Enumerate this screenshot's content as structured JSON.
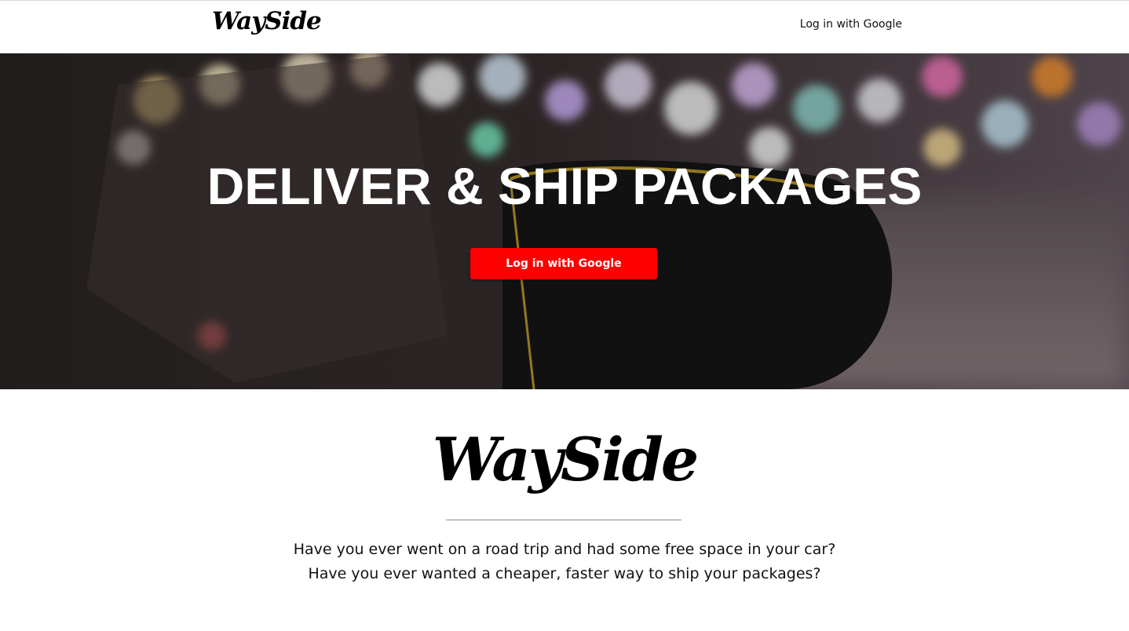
{
  "nav": {
    "brand": "WaySide",
    "login_label": "Log in with Google"
  },
  "hero": {
    "title": "DELIVER & SHIP PACKAGES",
    "button_label": "Log in with Google",
    "button_color": "#ff0000"
  },
  "about": {
    "brand": "WaySide",
    "line1": "Have you ever went on a road trip and had some free space in your car?",
    "line2": "Have you ever wanted a cheaper, faster way to ship your packages?"
  }
}
